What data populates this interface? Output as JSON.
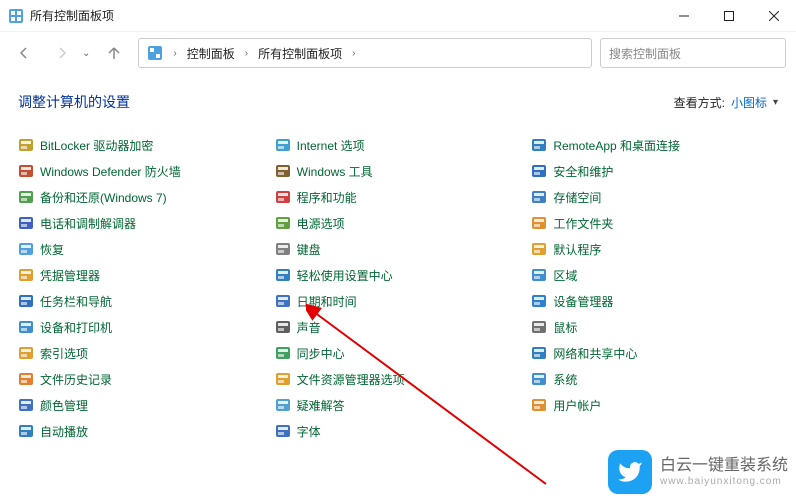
{
  "window": {
    "title": "所有控制面板项"
  },
  "nav": {
    "breadcrumbs": [
      "控制面板",
      "所有控制面板项"
    ],
    "search_placeholder": "搜索控制面板"
  },
  "header": {
    "title": "调整计算机的设置",
    "view_label": "查看方式:",
    "view_value": "小图标"
  },
  "columns": [
    [
      {
        "icon": "bitlocker",
        "label": "BitLocker 驱动器加密"
      },
      {
        "icon": "defender",
        "label": "Windows Defender 防火墙"
      },
      {
        "icon": "backup",
        "label": "备份和还原(Windows 7)"
      },
      {
        "icon": "phone",
        "label": "电话和调制解调器"
      },
      {
        "icon": "recovery",
        "label": "恢复"
      },
      {
        "icon": "credential",
        "label": "凭据管理器"
      },
      {
        "icon": "taskbar",
        "label": "任务栏和导航"
      },
      {
        "icon": "devices",
        "label": "设备和打印机"
      },
      {
        "icon": "indexing",
        "label": "索引选项"
      },
      {
        "icon": "filehistory",
        "label": "文件历史记录"
      },
      {
        "icon": "color",
        "label": "颜色管理"
      },
      {
        "icon": "autoplay",
        "label": "自动播放"
      }
    ],
    [
      {
        "icon": "internet",
        "label": "Internet 选项"
      },
      {
        "icon": "tools",
        "label": "Windows 工具"
      },
      {
        "icon": "programs",
        "label": "程序和功能"
      },
      {
        "icon": "power",
        "label": "电源选项"
      },
      {
        "icon": "keyboard",
        "label": "键盘"
      },
      {
        "icon": "ease",
        "label": "轻松使用设置中心"
      },
      {
        "icon": "date",
        "label": "日期和时间"
      },
      {
        "icon": "sound",
        "label": "声音"
      },
      {
        "icon": "sync",
        "label": "同步中心"
      },
      {
        "icon": "explorer",
        "label": "文件资源管理器选项"
      },
      {
        "icon": "troubleshoot",
        "label": "疑难解答"
      },
      {
        "icon": "fonts",
        "label": "字体"
      }
    ],
    [
      {
        "icon": "remote",
        "label": "RemoteApp 和桌面连接"
      },
      {
        "icon": "security",
        "label": "安全和维护"
      },
      {
        "icon": "storage",
        "label": "存储空间"
      },
      {
        "icon": "workfolders",
        "label": "工作文件夹"
      },
      {
        "icon": "default",
        "label": "默认程序"
      },
      {
        "icon": "region",
        "label": "区域"
      },
      {
        "icon": "devicemgr",
        "label": "设备管理器"
      },
      {
        "icon": "mouse",
        "label": "鼠标"
      },
      {
        "icon": "network",
        "label": "网络和共享中心"
      },
      {
        "icon": "system",
        "label": "系统"
      },
      {
        "icon": "users",
        "label": "用户帐户"
      }
    ]
  ],
  "watermark": {
    "main": "白云一键重装系统",
    "sub": "www.baiyunxitong.com"
  },
  "icon_colors": {
    "bitlocker": "#c0a030",
    "defender": "#c05030",
    "backup": "#50a050",
    "phone": "#4060c0",
    "recovery": "#50a0e0",
    "credential": "#e0a030",
    "taskbar": "#3070c0",
    "devices": "#4090d0",
    "indexing": "#e0a030",
    "filehistory": "#e08030",
    "color": "#4070c0",
    "autoplay": "#3080c0",
    "internet": "#40a0d0",
    "tools": "#806030",
    "programs": "#d04040",
    "power": "#60a040",
    "keyboard": "#808080",
    "ease": "#3080c0",
    "date": "#4070c0",
    "sound": "#606060",
    "sync": "#40a060",
    "explorer": "#e0a030",
    "troubleshoot": "#50a0d0",
    "fonts": "#4070c0",
    "remote": "#3080c0",
    "security": "#3070c0",
    "storage": "#4080c0",
    "workfolders": "#e09030",
    "default": "#e0a030",
    "region": "#4090d0",
    "devicemgr": "#3080d0",
    "mouse": "#707070",
    "network": "#3080c0",
    "system": "#4090d0",
    "users": "#e09030"
  }
}
